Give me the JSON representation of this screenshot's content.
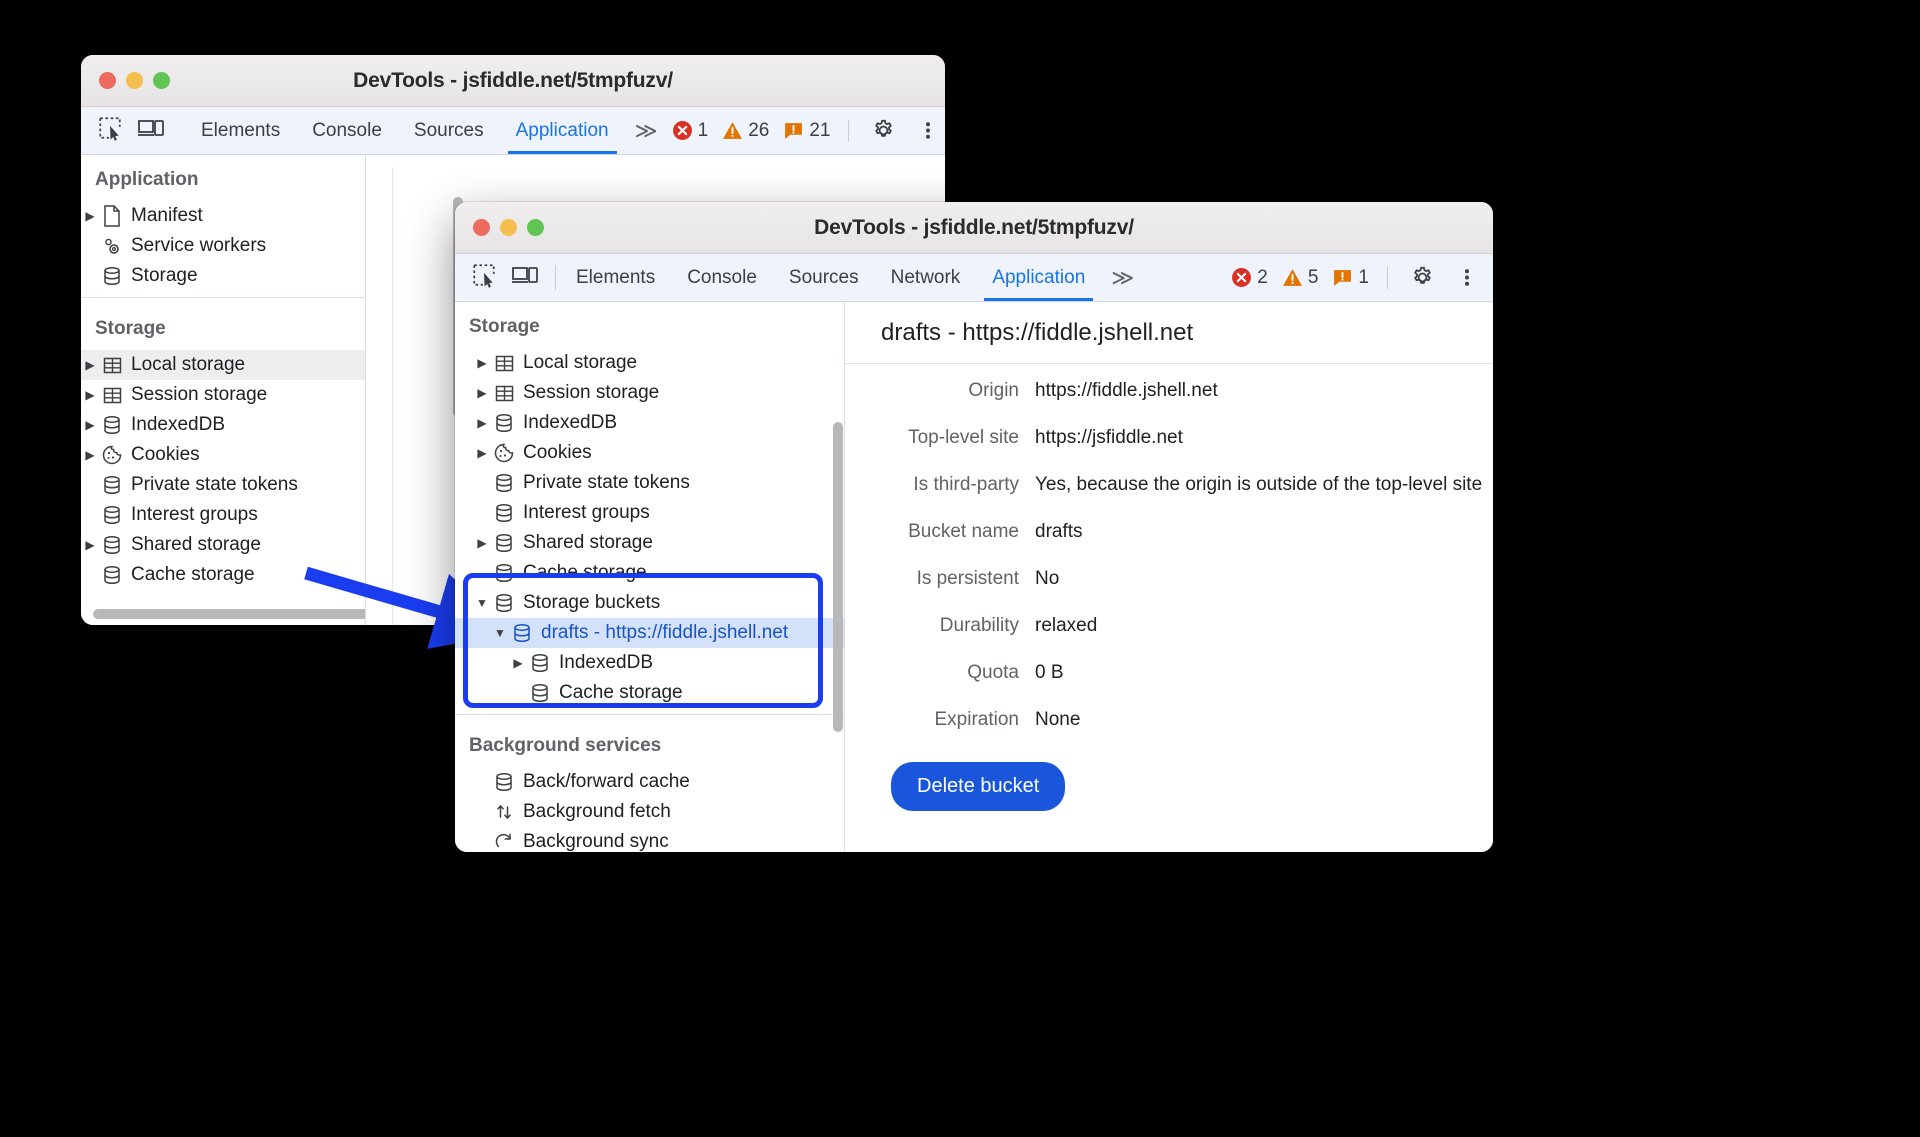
{
  "window1": {
    "title": "DevTools - jsfiddle.net/5tmpfuzv/",
    "tabs": [
      {
        "label": "Elements",
        "active": false
      },
      {
        "label": "Console",
        "active": false
      },
      {
        "label": "Sources",
        "active": false
      },
      {
        "label": "Application",
        "active": true
      }
    ],
    "more_label": "≫",
    "counters": {
      "errors": "1",
      "warnings": "26",
      "issues": "21"
    },
    "sections": [
      {
        "title": "Application",
        "items": [
          {
            "label": "Manifest",
            "icon": "document-icon",
            "expandable": true,
            "selected": false
          },
          {
            "label": "Service workers",
            "icon": "gears-icon",
            "expandable": false,
            "selected": false
          },
          {
            "label": "Storage",
            "icon": "database-icon",
            "expandable": false,
            "selected": false
          }
        ]
      },
      {
        "title": "Storage",
        "items": [
          {
            "label": "Local storage",
            "icon": "table-icon",
            "expandable": true,
            "selected": true
          },
          {
            "label": "Session storage",
            "icon": "table-icon",
            "expandable": true,
            "selected": false
          },
          {
            "label": "IndexedDB",
            "icon": "database-icon",
            "expandable": true,
            "selected": false
          },
          {
            "label": "Cookies",
            "icon": "cookie-icon",
            "expandable": true,
            "selected": false
          },
          {
            "label": "Private state tokens",
            "icon": "database-icon",
            "expandable": false,
            "selected": false
          },
          {
            "label": "Interest groups",
            "icon": "database-icon",
            "expandable": false,
            "selected": false
          },
          {
            "label": "Shared storage",
            "icon": "database-icon",
            "expandable": true,
            "selected": false
          },
          {
            "label": "Cache storage",
            "icon": "database-icon",
            "expandable": false,
            "selected": false
          }
        ]
      }
    ]
  },
  "window2": {
    "title": "DevTools - jsfiddle.net/5tmpfuzv/",
    "tabs": [
      {
        "label": "Elements",
        "active": false
      },
      {
        "label": "Console",
        "active": false
      },
      {
        "label": "Sources",
        "active": false
      },
      {
        "label": "Network",
        "active": false
      },
      {
        "label": "Application",
        "active": true
      }
    ],
    "more_label": "≫",
    "counters": {
      "errors": "2",
      "warnings": "5",
      "issues": "1"
    },
    "sections": [
      {
        "title": "Storage",
        "items": [
          {
            "label": "Local storage",
            "icon": "table-icon",
            "indent": 1,
            "expandable": true,
            "expanded": false,
            "selected": false
          },
          {
            "label": "Session storage",
            "icon": "table-icon",
            "indent": 1,
            "expandable": true,
            "expanded": false,
            "selected": false
          },
          {
            "label": "IndexedDB",
            "icon": "database-icon",
            "indent": 1,
            "expandable": true,
            "expanded": false,
            "selected": false
          },
          {
            "label": "Cookies",
            "icon": "cookie-icon",
            "indent": 1,
            "expandable": true,
            "expanded": false,
            "selected": false
          },
          {
            "label": "Private state tokens",
            "icon": "database-icon",
            "indent": 1,
            "expandable": false,
            "expanded": false,
            "selected": false
          },
          {
            "label": "Interest groups",
            "icon": "database-icon",
            "indent": 1,
            "expandable": false,
            "expanded": false,
            "selected": false
          },
          {
            "label": "Shared storage",
            "icon": "database-icon",
            "indent": 1,
            "expandable": true,
            "expanded": false,
            "selected": false
          },
          {
            "label": "Cache storage",
            "icon": "database-icon",
            "indent": 1,
            "expandable": false,
            "expanded": false,
            "selected": false
          },
          {
            "label": "Storage buckets",
            "icon": "database-icon",
            "indent": 1,
            "expandable": true,
            "expanded": true,
            "selected": false
          },
          {
            "label": "drafts - https://fiddle.jshell.net",
            "icon": "database-icon",
            "indent": 2,
            "expandable": true,
            "expanded": true,
            "selected": true
          },
          {
            "label": "IndexedDB",
            "icon": "database-icon",
            "indent": 3,
            "expandable": true,
            "expanded": false,
            "selected": false
          },
          {
            "label": "Cache storage",
            "icon": "database-icon",
            "indent": 3,
            "expandable": false,
            "expanded": false,
            "selected": false
          }
        ]
      },
      {
        "title": "Background services",
        "items": [
          {
            "label": "Back/forward cache",
            "icon": "database-icon",
            "indent": 1,
            "expandable": false,
            "expanded": false,
            "selected": false
          },
          {
            "label": "Background fetch",
            "icon": "updown-arrows-icon",
            "indent": 1,
            "expandable": false,
            "expanded": false,
            "selected": false
          },
          {
            "label": "Background sync",
            "icon": "sync-icon",
            "indent": 1,
            "expandable": false,
            "expanded": false,
            "selected": false
          }
        ]
      }
    ],
    "detail": {
      "header": "drafts - https://fiddle.jshell.net",
      "rows": [
        {
          "key": "Origin",
          "value": "https://fiddle.jshell.net"
        },
        {
          "key": "Top-level site",
          "value": "https://jsfiddle.net"
        },
        {
          "key": "Is third-party",
          "value": "Yes, because the origin is outside of the top-level site"
        },
        {
          "key": "Bucket name",
          "value": "drafts"
        },
        {
          "key": "Is persistent",
          "value": "No"
        },
        {
          "key": "Durability",
          "value": "relaxed"
        },
        {
          "key": "Quota",
          "value": "0 B"
        },
        {
          "key": "Expiration",
          "value": "None"
        }
      ],
      "delete_button": "Delete bucket"
    }
  },
  "colors": {
    "accent_blue": "#1a73e8",
    "highlight_border": "#1a3df0",
    "selected_row": "#d3e1fb",
    "error_red": "#d93025",
    "warning_orange": "#e37400",
    "delete_button": "#1a56db"
  }
}
